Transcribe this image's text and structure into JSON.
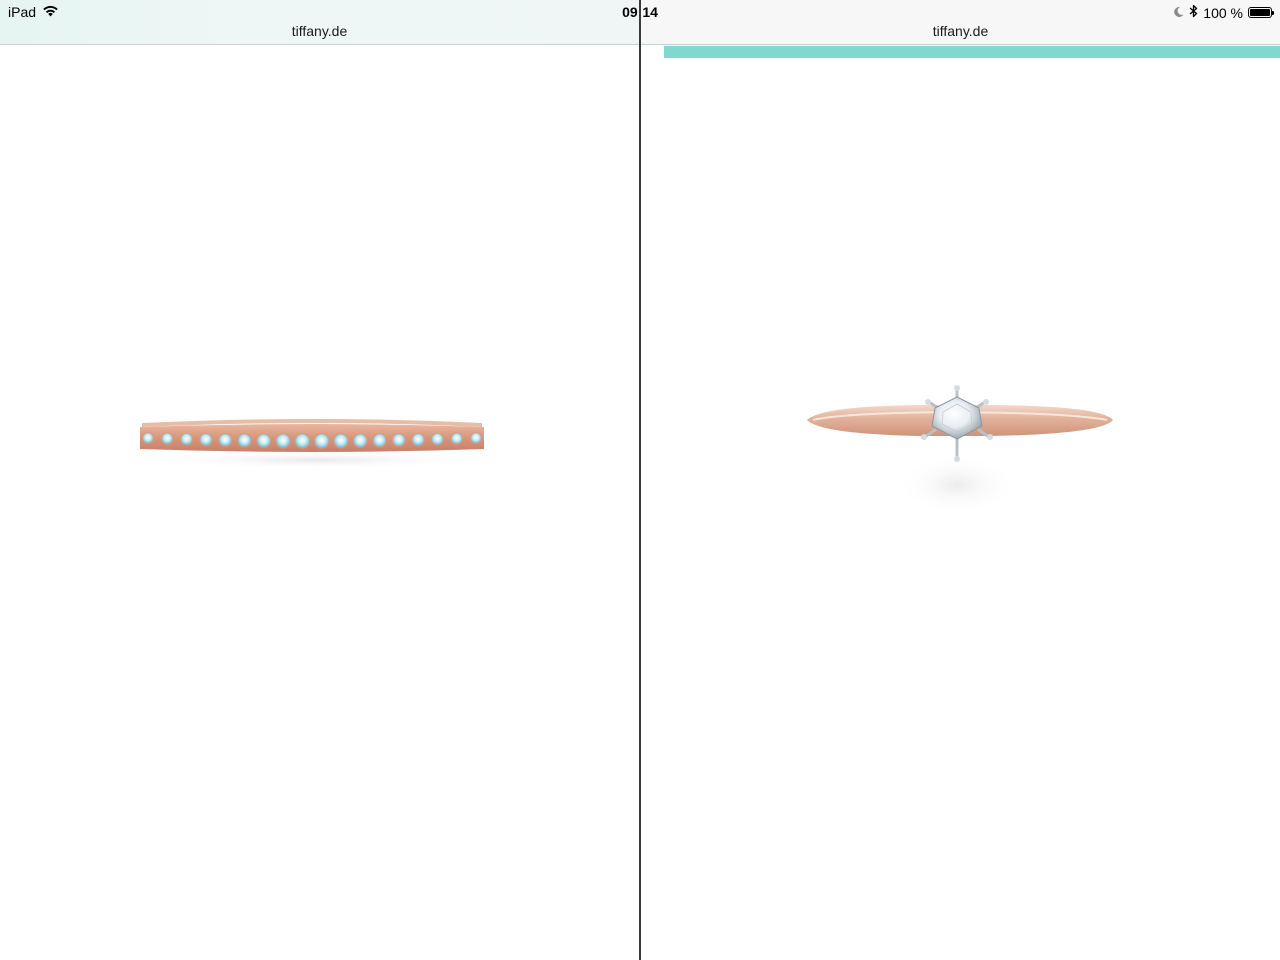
{
  "status_bar": {
    "device": "iPad",
    "time": "09:14",
    "battery": "100 %",
    "battery_level": 1.0,
    "icons": [
      "wifi-icon",
      "moon-icon",
      "bluetooth-icon",
      "battery-icon"
    ]
  },
  "panes": {
    "left": {
      "url": "tiffany.de",
      "product_image": "rose-gold-diamond-eternity-band"
    },
    "right": {
      "url": "tiffany.de",
      "product_image": "rose-gold-solitaire-engagement-ring",
      "accent_color": "#81d8d0"
    }
  }
}
